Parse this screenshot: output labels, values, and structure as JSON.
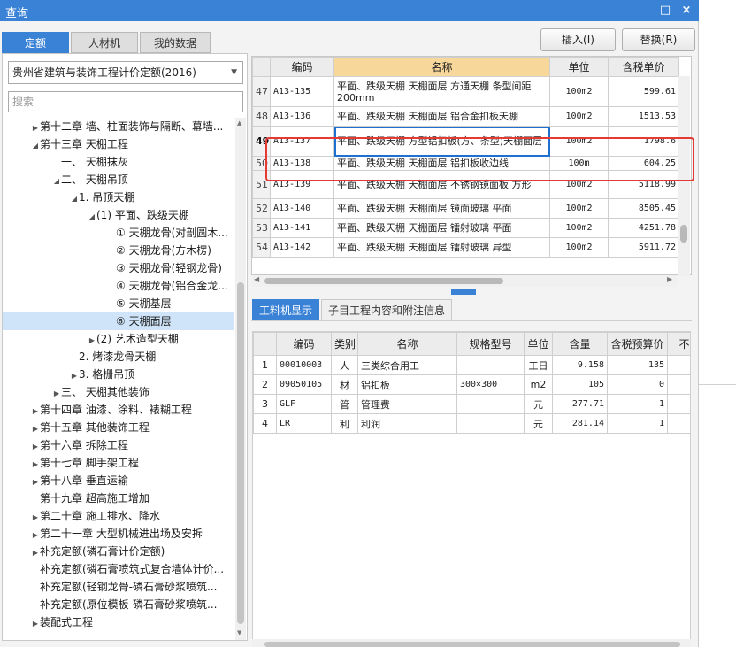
{
  "window": {
    "title": "查询",
    "restore_glyph": "□",
    "close_glyph": "×"
  },
  "tabs": [
    {
      "label": "定额",
      "active": true
    },
    {
      "label": "人材机",
      "active": false
    },
    {
      "label": "我的数据",
      "active": false
    }
  ],
  "buttons": {
    "insert": "插入(I)",
    "replace": "替换(R)"
  },
  "library_select": {
    "value": "贵州省建筑与装饰工程计价定额(2016)"
  },
  "search": {
    "placeholder": "搜索"
  },
  "tree": [
    {
      "label": "第十二章 墙、柱面装饰与隔断、幕墙...",
      "level": 0,
      "caret": "right"
    },
    {
      "label": "第十三章 天棚工程",
      "level": 0,
      "caret": "down"
    },
    {
      "label": "一、 天棚抹灰",
      "level": 1,
      "caret": "none"
    },
    {
      "label": "二、 天棚吊顶",
      "level": 1,
      "caret": "down"
    },
    {
      "label": "1. 吊顶天棚",
      "level": 2,
      "caret": "down"
    },
    {
      "label": "(1) 平面、跌级天棚",
      "level": 3,
      "caret": "down"
    },
    {
      "label": "① 天棚龙骨(对剖圆木...",
      "level": 4,
      "caret": "none"
    },
    {
      "label": "② 天棚龙骨(方木楞)",
      "level": 4,
      "caret": "none"
    },
    {
      "label": "③ 天棚龙骨(轻钢龙骨)",
      "level": 4,
      "caret": "none"
    },
    {
      "label": "④ 天棚龙骨(铝合金龙...",
      "level": 4,
      "caret": "none"
    },
    {
      "label": "⑤ 天棚基层",
      "level": 4,
      "caret": "none"
    },
    {
      "label": "⑥ 天棚面层",
      "level": 4,
      "caret": "none",
      "selected": true
    },
    {
      "label": "(2) 艺术造型天棚",
      "level": 3,
      "caret": "right"
    },
    {
      "label": "2. 烤漆龙骨天棚",
      "level": 2,
      "caret": "none"
    },
    {
      "label": "3. 格栅吊顶",
      "level": 2,
      "caret": "right"
    },
    {
      "label": "三、 天棚其他装饰",
      "level": 1,
      "caret": "right"
    },
    {
      "label": "第十四章 油漆、涂料、裱糊工程",
      "level": 0,
      "caret": "right"
    },
    {
      "label": "第十五章 其他装饰工程",
      "level": 0,
      "caret": "right"
    },
    {
      "label": "第十六章 拆除工程",
      "level": 0,
      "caret": "right"
    },
    {
      "label": "第十七章 脚手架工程",
      "level": 0,
      "caret": "right"
    },
    {
      "label": "第十八章 垂直运输",
      "level": 0,
      "caret": "right"
    },
    {
      "label": "第十九章 超高施工增加",
      "level": 0,
      "caret": "none"
    },
    {
      "label": "第二十章 施工排水、降水",
      "level": 0,
      "caret": "right"
    },
    {
      "label": "第二十一章 大型机械进出场及安拆",
      "level": 0,
      "caret": "right"
    },
    {
      "label": "补充定额(磷石膏计价定额)",
      "level": 0,
      "caret": "right"
    },
    {
      "label": "补充定额(磷石膏喷筑式复合墙体计价...",
      "level": 0,
      "caret": "none"
    },
    {
      "label": "补充定额(轻钢龙骨-磷石膏砂浆喷筑...",
      "level": 0,
      "caret": "none"
    },
    {
      "label": "补充定额(原位模板-磷石膏砂浆喷筑...",
      "level": 0,
      "caret": "none"
    },
    {
      "label": "装配式工程",
      "level": 0,
      "caret": "right"
    }
  ],
  "quota_grid": {
    "columns": [
      "编码",
      "名称",
      "单位",
      "含税单价"
    ],
    "rows": [
      {
        "no": "47",
        "code": "A13-135",
        "name": "平面、跌级天棚 天棚面层 方通天棚 条型间距200mm",
        "unit": "100m2",
        "price": "599.61"
      },
      {
        "no": "48",
        "code": "A13-136",
        "name": "平面、跌级天棚 天棚面层 铝合金扣板天棚",
        "unit": "100m2",
        "price": "1513.53"
      },
      {
        "no": "49",
        "code": "A13-137",
        "name": "平面、跌级天棚 方型铝扣板(方、条型)天棚面层",
        "unit": "100m2",
        "price": "1798.6",
        "current": true
      },
      {
        "no": "50",
        "code": "A13-138",
        "name": "平面、跌级天棚 天棚面层 铝扣板收边线",
        "unit": "100m",
        "price": "604.25"
      },
      {
        "no": "51",
        "code": "A13-139",
        "name": "平面、跌级天棚 天棚面层 不锈钢镜面板 方形",
        "unit": "100m2",
        "price": "5118.99"
      },
      {
        "no": "52",
        "code": "A13-140",
        "name": "平面、跌级天棚 天棚面层 镜面玻璃 平面",
        "unit": "100m2",
        "price": "8505.45"
      },
      {
        "no": "53",
        "code": "A13-141",
        "name": "平面、跌级天棚 天棚面层 镭射玻璃 平面",
        "unit": "100m2",
        "price": "4251.78"
      },
      {
        "no": "54",
        "code": "A13-142",
        "name": "平面、跌级天棚 天棚面层 镭射玻璃 异型",
        "unit": "100m2",
        "price": "5911.72"
      }
    ]
  },
  "bottom_tabs": [
    {
      "label": "工料机显示",
      "active": true
    },
    {
      "label": "子目工程内容和附注信息",
      "active": false
    }
  ],
  "material_grid": {
    "columns": [
      "编码",
      "类别",
      "名称",
      "规格型号",
      "单位",
      "含量",
      "含税预算价",
      "不"
    ],
    "rows": [
      {
        "no": "1",
        "code": "00010003",
        "cat": "人",
        "name": "三类综合用工",
        "spec": "",
        "unit": "工日",
        "qty": "9.158",
        "price": "135"
      },
      {
        "no": "2",
        "code": "09050105",
        "cat": "材",
        "name": "铝扣板",
        "spec": "300×300",
        "unit": "m2",
        "qty": "105",
        "price": "0"
      },
      {
        "no": "3",
        "code": "GLF",
        "cat": "管",
        "name": "管理费",
        "spec": "",
        "unit": "元",
        "qty": "277.71",
        "price": "1"
      },
      {
        "no": "4",
        "code": "LR",
        "cat": "利",
        "name": "利润",
        "spec": "",
        "unit": "元",
        "qty": "281.14",
        "price": "1"
      }
    ]
  },
  "colors": {
    "accent": "#3a82d6",
    "header_highlight": "#f8d79a",
    "annotation_red": "#e53935",
    "selection": "#cfe4f8"
  }
}
